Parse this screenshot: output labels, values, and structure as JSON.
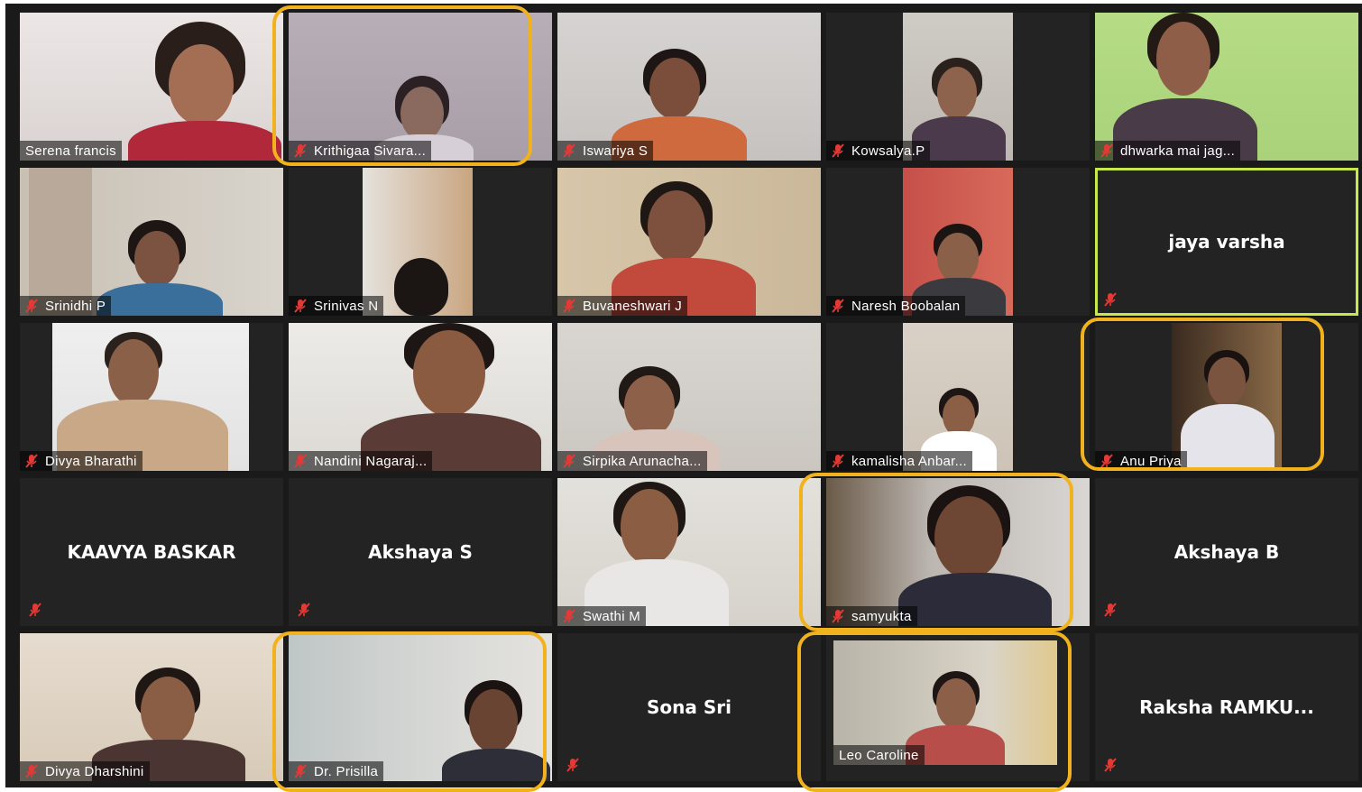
{
  "colors": {
    "highlight": "#f2b21d",
    "active_speaker": "#c7e84a",
    "muted_icon": "#e53935"
  },
  "participants": [
    {
      "name": "Serena francis"
    },
    {
      "name": "Krithigaa Sivara..."
    },
    {
      "name": "Iswariya S"
    },
    {
      "name": "Kowsalya.P"
    },
    {
      "name": "dhwarka mai jag..."
    },
    {
      "name": "Srinidhi P"
    },
    {
      "name": "Srinivas N"
    },
    {
      "name": "Buvaneshwari J"
    },
    {
      "name": "Naresh Boobalan"
    },
    {
      "name": "jaya varsha"
    },
    {
      "name": "Divya Bharathi"
    },
    {
      "name": "Nandini Nagaraj..."
    },
    {
      "name": "Sirpika Arunacha..."
    },
    {
      "name": "kamalisha Anbar..."
    },
    {
      "name": "Anu Priya"
    },
    {
      "name": "KAAVYA BASKAR"
    },
    {
      "name": "Akshaya S"
    },
    {
      "name": "Swathi M"
    },
    {
      "name": "samyukta"
    },
    {
      "name": "Akshaya B"
    },
    {
      "name": "Divya Dharshini"
    },
    {
      "name": "Dr. Prisilla"
    },
    {
      "name": "Sona Sri"
    },
    {
      "name": "Leo Caroline"
    },
    {
      "name": "Raksha  RAMKU..."
    }
  ]
}
